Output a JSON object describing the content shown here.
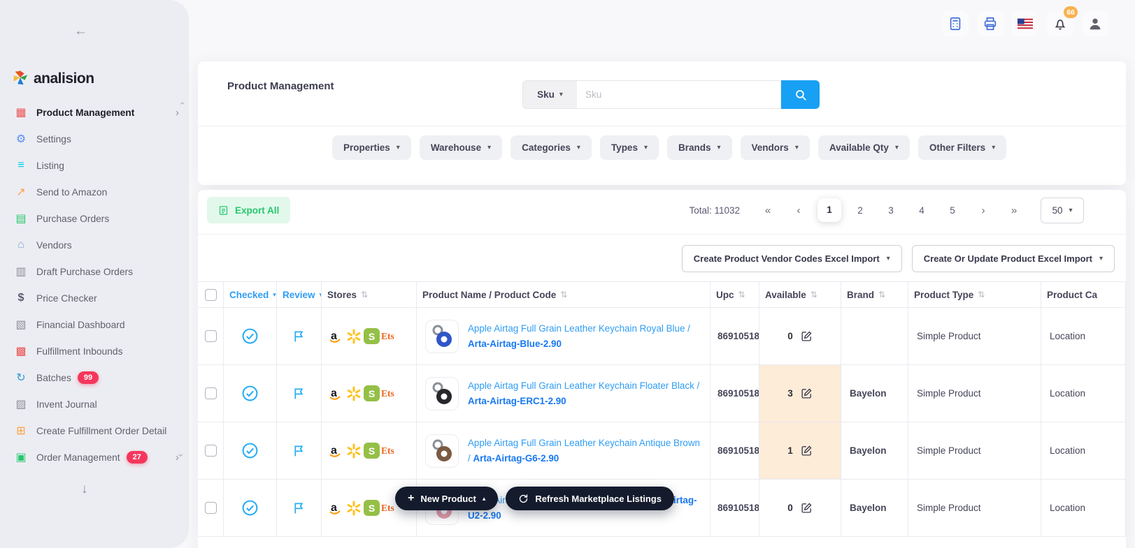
{
  "colors": {
    "accent": "#18a0f4",
    "link": "#2f9df5",
    "linkbold": "#1778f2",
    "badge": "#f5365c",
    "notif": "#f8b24f",
    "green": "#28c76f",
    "greenbg": "#e2f8eb",
    "dark": "#141b2d",
    "highlight": "#fcecd8"
  },
  "icons": {
    "sort": "⇅",
    "caret_down": "▾",
    "caret_up": "▴",
    "chevron_right": "›",
    "arrow_left": "←",
    "arrow_down": "↓",
    "pg_first": "«",
    "pg_prev": "‹",
    "pg_next": "›",
    "pg_last": "»",
    "plus": "+"
  },
  "topbar": {
    "notification_count": "66"
  },
  "sidebar": {
    "logo_text": "analision",
    "items": [
      {
        "glyph": "▦",
        "label": "Product Management"
      },
      {
        "glyph": "⚙",
        "label": "Settings"
      },
      {
        "glyph": "≡",
        "label": "Listing"
      },
      {
        "glyph": "↗",
        "label": "Send to Amazon"
      },
      {
        "glyph": "▤",
        "label": "Purchase Orders"
      },
      {
        "glyph": "⌂",
        "label": "Vendors"
      },
      {
        "glyph": "▥",
        "label": "Draft Purchase Orders"
      },
      {
        "glyph": "$",
        "label": "Price Checker"
      },
      {
        "glyph": "▧",
        "label": "Financial Dashboard"
      },
      {
        "glyph": "▩",
        "label": "Fulfillment Inbounds"
      },
      {
        "glyph": "↻",
        "label": "Batches",
        "badge": "99"
      },
      {
        "glyph": "▨",
        "label": "Invent Journal"
      },
      {
        "glyph": "⊞",
        "label": "Create Fulfillment Order Detail"
      },
      {
        "glyph": "▣",
        "label": "Order Management",
        "badge": "27"
      }
    ]
  },
  "page": {
    "title": "Product Management",
    "search_field": "Sku",
    "search_placeholder": "Sku",
    "filters": [
      "Properties",
      "Warehouse",
      "Categories",
      "Types",
      "Brands",
      "Vendors",
      "Available Qty",
      "Other Filters"
    ]
  },
  "toolbar": {
    "export": "Export All",
    "total": "Total: 11032",
    "pages": [
      "1",
      "2",
      "3",
      "4",
      "5"
    ],
    "active_page": "1",
    "page_size": "50",
    "import_vendor_codes": "Create Product Vendor Codes Excel Import",
    "import_products": "Create Or Update Product Excel Import"
  },
  "table": {
    "headers": {
      "checked": "Checked",
      "review": "Review",
      "stores": "Stores",
      "product": "Product Name / Product Code",
      "upc": "Upc",
      "available": "Available",
      "brand": "Brand",
      "type": "Product Type",
      "category": "Product Ca"
    },
    "rows": [
      {
        "name": "Apple Airtag Full Grain Leather Keychain Royal Blue /",
        "code": "Arta-Airtag-Blue-2.90",
        "upc": "86910518",
        "available": "0",
        "brand": "",
        "type": "Simple Product",
        "category": "Location"
      },
      {
        "name": "Apple Airtag Full Grain Leather Keychain Floater Black /",
        "code": "Arta-Airtag-ERC1-2.90",
        "upc": "86910518",
        "available": "3",
        "brand": "Bayelon",
        "type": "Simple Product",
        "category": "Location"
      },
      {
        "name": "Apple Airtag Full Grain Leather Keychain Antique Brown /",
        "code": "Arta-Airtag-G6-2.90",
        "upc": "86910518",
        "available": "1",
        "brand": "Bayelon",
        "type": "Simple Product",
        "category": "Location"
      },
      {
        "name": "Apple Airtag Full Grain Leather Keychain /",
        "code": "Arta-Airtag-U2-2.90",
        "upc": "86910518",
        "available": "0",
        "brand": "Bayelon",
        "type": "Simple Product",
        "category": "Location"
      }
    ]
  },
  "actions": {
    "new_product": "New Product",
    "refresh": "Refresh Marketplace Listings"
  }
}
